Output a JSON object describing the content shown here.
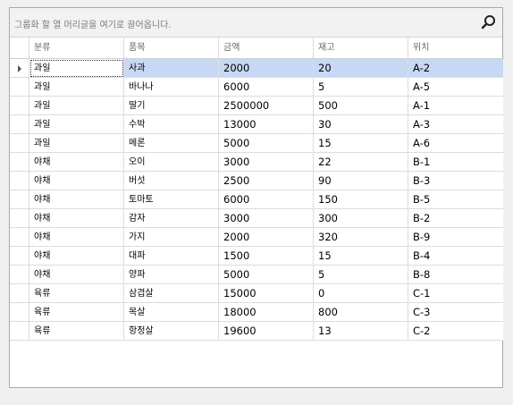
{
  "group_panel": {
    "hint": "그룹화 할 열 머리글을 여기로 끌어옵니다."
  },
  "columns": [
    "분류",
    "품목",
    "금액",
    "재고",
    "위치"
  ],
  "rows": [
    [
      "과일",
      "사과",
      "2000",
      "20",
      "A-2"
    ],
    [
      "과일",
      "바나나",
      "6000",
      "5",
      "A-5"
    ],
    [
      "과일",
      "딸기",
      "2500000",
      "500",
      "A-1"
    ],
    [
      "과일",
      "수박",
      "13000",
      "30",
      "A-3"
    ],
    [
      "과일",
      "메론",
      "5000",
      "15",
      "A-6"
    ],
    [
      "야채",
      "오이",
      "3000",
      "22",
      "B-1"
    ],
    [
      "야채",
      "버섯",
      "2500",
      "90",
      "B-3"
    ],
    [
      "야채",
      "토마토",
      "6000",
      "150",
      "B-5"
    ],
    [
      "야채",
      "감자",
      "3000",
      "300",
      "B-2"
    ],
    [
      "야채",
      "가지",
      "2000",
      "320",
      "B-9"
    ],
    [
      "야채",
      "대파",
      "1500",
      "15",
      "B-4"
    ],
    [
      "야채",
      "양파",
      "5000",
      "5",
      "B-8"
    ],
    [
      "육류",
      "삼겹살",
      "15000",
      "0",
      "C-1"
    ],
    [
      "육류",
      "목살",
      "18000",
      "800",
      "C-3"
    ],
    [
      "육류",
      "항정살",
      "19600",
      "13",
      "C-2"
    ]
  ],
  "selected_row": 0,
  "icons": {
    "search": "search-icon",
    "row_indicator": "triangle-right-icon"
  },
  "colors": {
    "selection": "#c7d8f4",
    "grid_line": "#dcdcdc"
  }
}
